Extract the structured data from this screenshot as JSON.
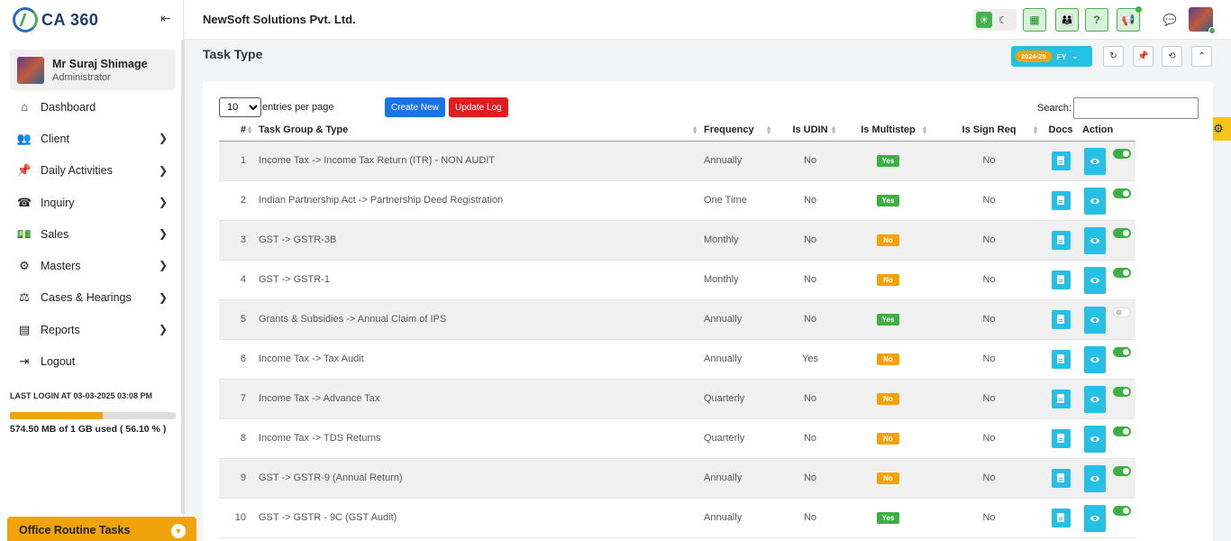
{
  "app": {
    "logo_text": "CA 360",
    "company": "NewSoft Solutions Pvt. Ltd."
  },
  "profile": {
    "name": "Mr Suraj Shimage",
    "role": "Administrator"
  },
  "sidebar": {
    "items": [
      {
        "label": "Dashboard",
        "icon": "home-icon"
      },
      {
        "label": "Client",
        "icon": "users-icon"
      },
      {
        "label": "Daily Activities",
        "icon": "pin-icon"
      },
      {
        "label": "Inquiry",
        "icon": "phone-icon"
      },
      {
        "label": "Sales",
        "icon": "money-icon"
      },
      {
        "label": "Masters",
        "icon": "gears-icon"
      },
      {
        "label": "Cases & Hearings",
        "icon": "scale-icon"
      },
      {
        "label": "Reports",
        "icon": "file-icon"
      },
      {
        "label": "Logout",
        "icon": "logout-icon"
      }
    ],
    "last_login": "LAST LOGIN AT 03-03-2025 03:08 PM",
    "storage_text": "574.50 MB of 1 GB used ( 56.10 % )",
    "storage_fraction": 0.561,
    "office_tasks": "Office Routine Tasks"
  },
  "page": {
    "title": "Task Type",
    "fy_year": "2024-25",
    "fy_label": "FY"
  },
  "toolbar": {
    "entries_value": "10",
    "entries_label": "entries per page",
    "create_label": "Create New",
    "update_log_label": "Update Log",
    "search_label": "Search:"
  },
  "table": {
    "headers": {
      "num": "#",
      "task": "Task Group & Type",
      "frequency": "Frequency",
      "udin": "Is UDIN",
      "multistep": "Is Multistep",
      "sign": "Is Sign Req",
      "docs": "Docs",
      "action": "Action"
    },
    "rows": [
      {
        "num": "1",
        "task": "Income Tax -> Income Tax Return (ITR) - NON AUDIT",
        "frequency": "Annually",
        "udin": "No",
        "multistep": "Yes",
        "sign": "No",
        "enabled": true
      },
      {
        "num": "2",
        "task": "Indian Partnership Act -> Partnership Deed Registration",
        "frequency": "One Time",
        "udin": "No",
        "multistep": "Yes",
        "sign": "No",
        "enabled": true
      },
      {
        "num": "3",
        "task": "GST -> GSTR-3B",
        "frequency": "Monthly",
        "udin": "No",
        "multistep": "No",
        "sign": "No",
        "enabled": true
      },
      {
        "num": "4",
        "task": "GST -> GSTR-1",
        "frequency": "Monthly",
        "udin": "No",
        "multistep": "No",
        "sign": "No",
        "enabled": true
      },
      {
        "num": "5",
        "task": "Grants & Subsidies -> Annual Claim of IPS",
        "frequency": "Annually",
        "udin": "No",
        "multistep": "Yes",
        "sign": "No",
        "enabled": false
      },
      {
        "num": "6",
        "task": "Income Tax -> Tax Audit",
        "frequency": "Annually",
        "udin": "Yes",
        "multistep": "No",
        "sign": "No",
        "enabled": true
      },
      {
        "num": "7",
        "task": "Income Tax -> Advance Tax",
        "frequency": "Quarterly",
        "udin": "No",
        "multistep": "No",
        "sign": "No",
        "enabled": true
      },
      {
        "num": "8",
        "task": "Income Tax -> TDS Returns",
        "frequency": "Quarterly",
        "udin": "No",
        "multistep": "No",
        "sign": "No",
        "enabled": true
      },
      {
        "num": "9",
        "task": "GST -> GSTR-9 (Annual Return)",
        "frequency": "Annually",
        "udin": "No",
        "multistep": "No",
        "sign": "No",
        "enabled": true
      },
      {
        "num": "10",
        "task": "GST -> GSTR - 9C (GST Audit)",
        "frequency": "Annually",
        "udin": "No",
        "multistep": "Yes",
        "sign": "No",
        "enabled": true
      }
    ]
  },
  "colors": {
    "accent": "#25c0e4",
    "green": "#3cb043",
    "orange": "#f7a10a",
    "red": "#e01e1e",
    "blue": "#1a73e8"
  }
}
